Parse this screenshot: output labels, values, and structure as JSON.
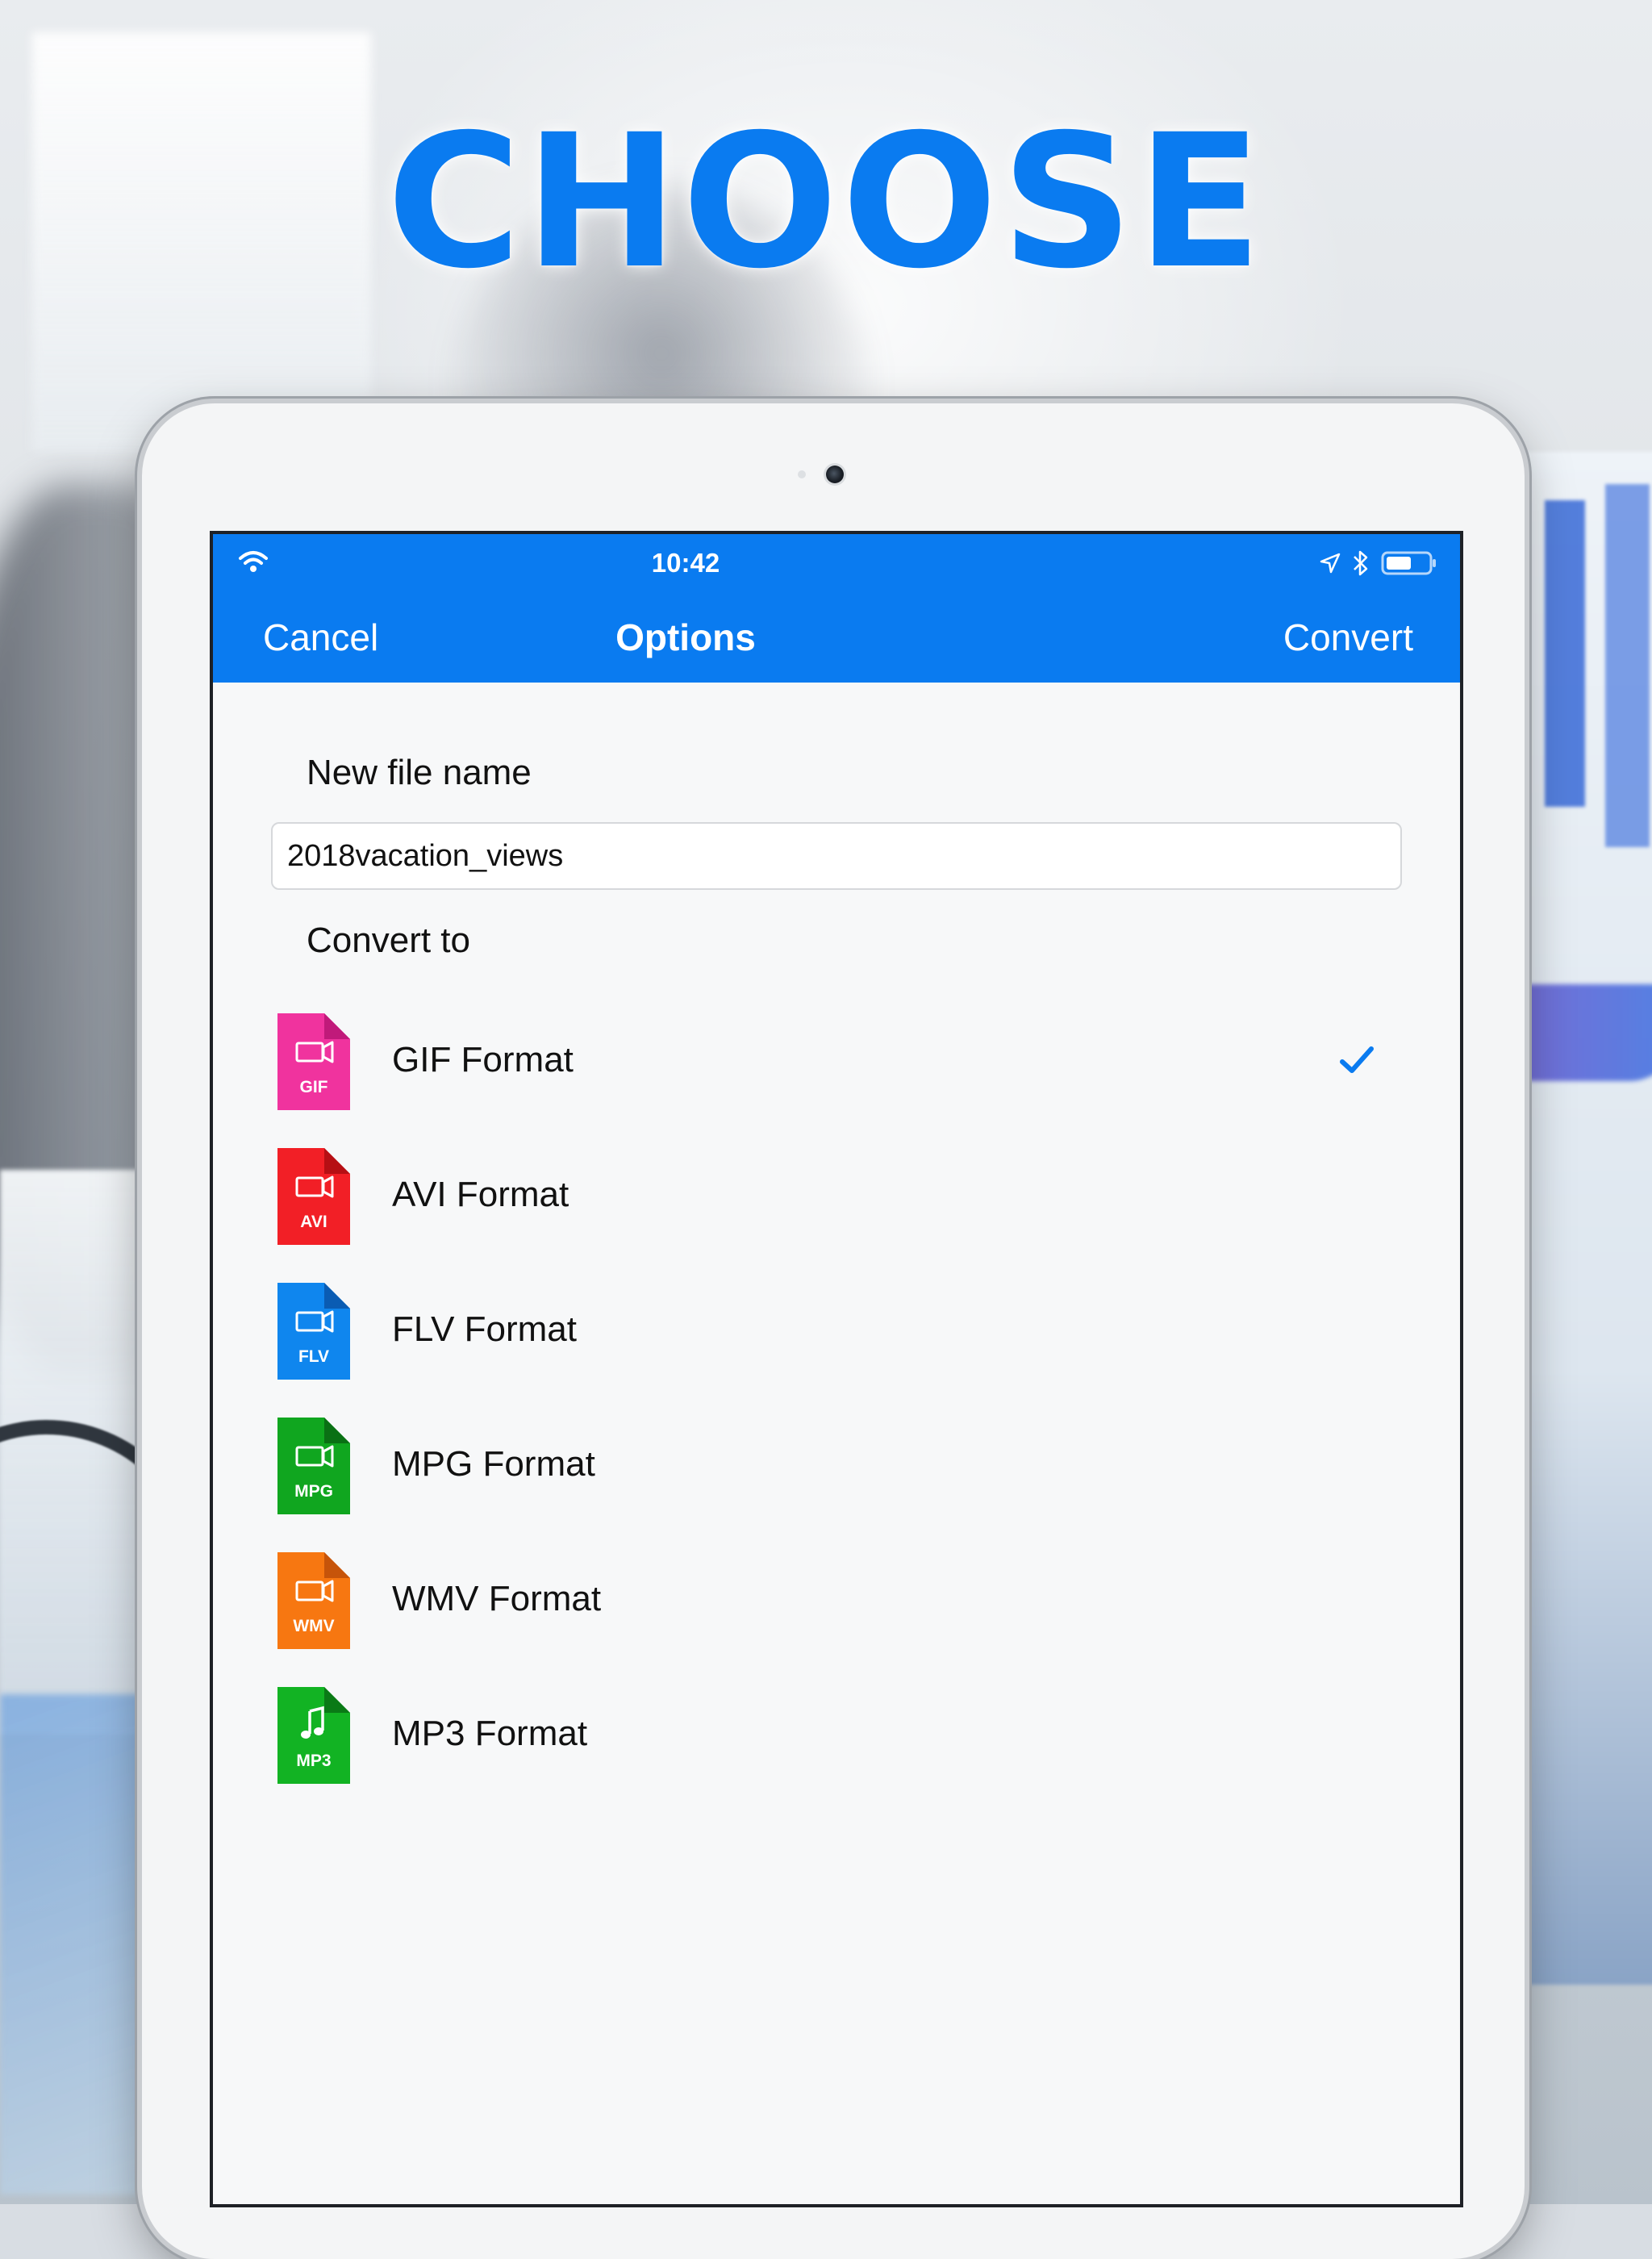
{
  "headline": "CHOOSE",
  "status_bar": {
    "time": "10:42",
    "wifi_icon": "wifi-icon",
    "location_icon": "location-arrow-icon",
    "bluetooth_icon": "bluetooth-icon",
    "battery_icon": "battery-icon"
  },
  "nav": {
    "cancel_label": "Cancel",
    "title": "Options",
    "convert_label": "Convert"
  },
  "file_name": {
    "label": "New file name",
    "value": "2018vacation_views"
  },
  "convert_to": {
    "label": "Convert to",
    "selected": "GIF Format",
    "formats": [
      {
        "label": "GIF Format",
        "icon_text": "GIF",
        "icon": "video-file-icon",
        "color": "#f0339e",
        "fold": "#c01a7a",
        "selected": true
      },
      {
        "label": "AVI Format",
        "icon_text": "AVI",
        "icon": "video-file-icon",
        "color": "#f21f26",
        "fold": "#b60f14",
        "selected": false
      },
      {
        "label": "FLV Format",
        "icon_text": "FLV",
        "icon": "video-file-icon",
        "color": "#0f86ee",
        "fold": "#0a5cb3",
        "selected": false
      },
      {
        "label": "MPG Format",
        "icon_text": "MPG",
        "icon": "video-file-icon",
        "color": "#10a61f",
        "fold": "#0a7014",
        "selected": false
      },
      {
        "label": "WMV Format",
        "icon_text": "WMV",
        "icon": "video-file-icon",
        "color": "#f77711",
        "fold": "#c6540a",
        "selected": false
      },
      {
        "label": "MP3 Format",
        "icon_text": "MP3",
        "icon": "music-file-icon",
        "color": "#12b323",
        "fold": "#0a7a16",
        "selected": false
      }
    ]
  },
  "colors": {
    "accent": "#0a7bf0",
    "check": "#0a7bf0"
  }
}
